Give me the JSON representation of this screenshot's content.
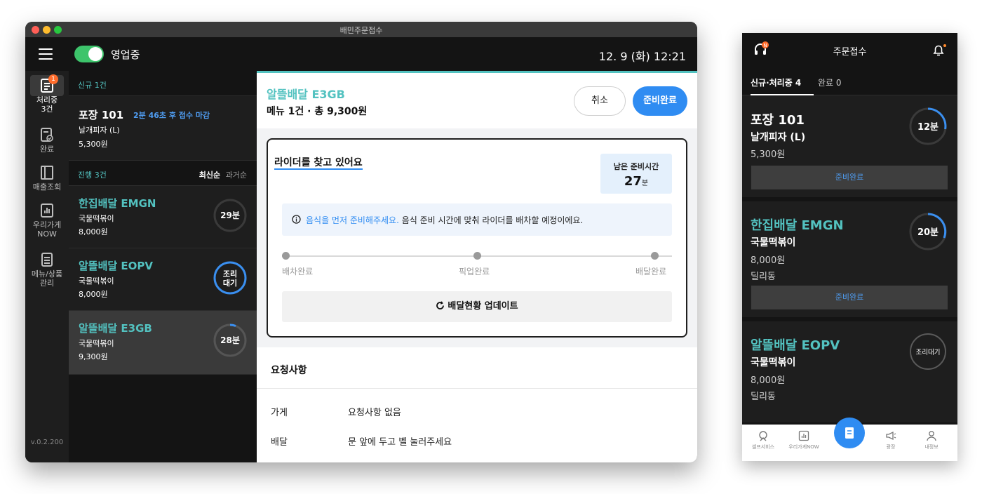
{
  "window": {
    "title": "배민주문접수"
  },
  "appbar": {
    "status": "영업중",
    "datetime": "12. 9 (화) 12:21"
  },
  "nav": {
    "items": [
      {
        "label": "처리중\n3건",
        "badge": "1"
      },
      {
        "label": "완료"
      },
      {
        "label": "매출조회"
      },
      {
        "label": "우리가게\nNOW"
      },
      {
        "label": "메뉴/상품\n관리"
      }
    ],
    "version": "v.0.2.200"
  },
  "list": {
    "new_header": "신규 1건",
    "new_card": {
      "title": "포장 101",
      "deadline": "2분 46초 후 접수 마감",
      "menu": "날개피자 (L)",
      "price": "5,300원"
    },
    "progress_header": "진행 3건",
    "sort_latest": "최신순",
    "sort_oldest": "과거순",
    "cards": [
      {
        "title": "한집배달 EMGN",
        "menu": "국물떡볶이",
        "price": "8,000원",
        "ring": "29분",
        "progress": 0.0
      },
      {
        "title": "알뜰배달 EOPV",
        "menu": "국물떡볶이",
        "price": "8,000원",
        "ring1": "조리",
        "ring2": "대기",
        "progress": 1.0
      },
      {
        "title": "알뜰배달 E3GB",
        "menu": "국물떡볶이",
        "price": "9,300원",
        "ring": "28분",
        "progress": 0.06
      }
    ]
  },
  "detail": {
    "title": "알뜰배달 E3GB",
    "summary": "메뉴 1건 · 총 9,300원",
    "cancel": "취소",
    "done": "준비완료",
    "rider_heading": "라이더를 찾고 있어요",
    "remain_label": "남은 준비시간",
    "remain_value": "27",
    "remain_unit": "분",
    "info_highlight": "음식을 먼저 준비해주세요.",
    "info_rest": " 음식 준비 시간에 맞춰 라이더를 배차할 예정이에요.",
    "steps": [
      "배차완료",
      "픽업완료",
      "배달완료"
    ],
    "update_button": "배달현황 업데이트",
    "request_heading": "요청사항",
    "requests": [
      {
        "key": "가게",
        "value": "요청사항 없음"
      },
      {
        "key": "배달",
        "value": "문 앞에 두고 벨 눌러주세요"
      }
    ]
  },
  "phone": {
    "title": "주문접수",
    "tab_active": "신규·처리중 4",
    "tab_done": "완료 0",
    "cards": [
      {
        "title": "포장 101",
        "menu": "날개피자 (L)",
        "price": "5,300원",
        "district": "",
        "ring": "12분",
        "button": "준비완료",
        "color": "#ffffff",
        "progress": 0.35
      },
      {
        "title": "한집배달 EMGN",
        "menu": "국물떡볶이",
        "price": "8,000원",
        "district": "딜리동",
        "ring": "20분",
        "button": "준비완료",
        "color": "#53c2c0",
        "progress": 0.4
      },
      {
        "title": "알뜰배달 EOPV",
        "menu": "국물떡볶이",
        "price": "8,000원",
        "district": "딜리동",
        "ring": "조리대기",
        "button": "",
        "color": "#53c2c0",
        "progress": 0.0
      }
    ],
    "bottom_nav": [
      "셀프서비스",
      "우리가게NOW",
      "",
      "광장",
      "내정보"
    ]
  },
  "colors": {
    "accent_teal": "#53c2c0",
    "primary_blue": "#2f8cf2",
    "toggle_green": "#3dc46b",
    "badge_orange": "#ff6d2d"
  }
}
